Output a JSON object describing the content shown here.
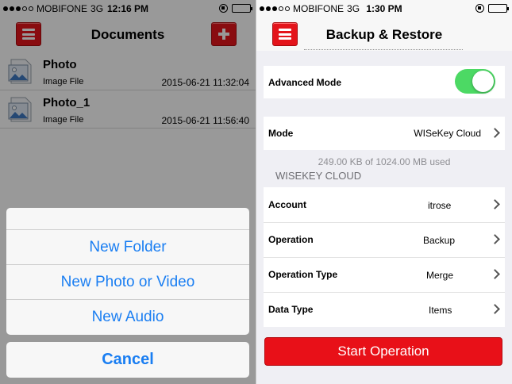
{
  "left": {
    "status": {
      "carrier": "MOBIFONE",
      "network": "3G",
      "time": "12:16 PM"
    },
    "nav": {
      "title": "Documents",
      "menu_icon": "menu-icon",
      "add_icon": "plus-icon"
    },
    "documents": [
      {
        "name": "Photo",
        "type": "Image File",
        "date": "2015-06-21 11:32:04",
        "icon": "image-file-icon"
      },
      {
        "name": "Photo_1",
        "type": "Image File",
        "date": "2015-06-21 11:56:40",
        "icon": "image-file-icon"
      }
    ],
    "action_sheet": {
      "items": [
        "New Folder",
        "New Photo or Video",
        "New Audio"
      ],
      "cancel": "Cancel"
    }
  },
  "right": {
    "status": {
      "carrier": "MOBIFONE",
      "network": "3G",
      "time": "1:30 PM"
    },
    "nav": {
      "title": "Backup & Restore",
      "menu_icon": "menu-icon"
    },
    "advanced_mode": {
      "label": "Advanced Mode",
      "on": true
    },
    "mode": {
      "label": "Mode",
      "value": "WISeKey Cloud"
    },
    "usage": "249.00 KB of 1024.00 MB used",
    "section_header": "WISEKEY CLOUD",
    "settings": [
      {
        "label": "Account",
        "value": "itrose"
      },
      {
        "label": "Operation",
        "value": "Backup"
      },
      {
        "label": "Operation Type",
        "value": "Merge"
      },
      {
        "label": "Data Type",
        "value": "Items"
      }
    ],
    "start_button": "Start Operation"
  },
  "colors": {
    "accent_red": "#e4141b",
    "ios_blue": "#1a7ef2",
    "toggle_green": "#4cd964"
  }
}
